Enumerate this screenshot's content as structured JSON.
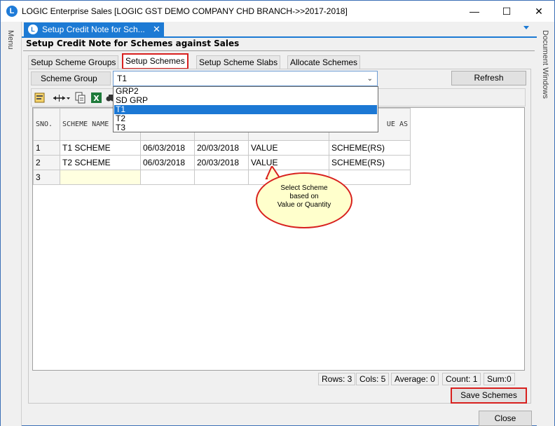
{
  "window": {
    "title": "LOGIC Enterprise Sales  [LOGIC GST DEMO COMPANY CHD BRANCH->>2017-2018]",
    "logo_letter": "L",
    "minimize": "—",
    "maximize": "☐",
    "close": "✕"
  },
  "side_rails": {
    "left_label": "Menu",
    "right_label": "Document Windows"
  },
  "doc_tab": {
    "label": "Setup Credit Note for Sch...",
    "close": "✕"
  },
  "form": {
    "title": "Setup Credit Note for Schemes against Sales"
  },
  "subtabs": [
    {
      "label": "Setup Scheme Groups",
      "active": false
    },
    {
      "label": "Setup Schemes",
      "active": true
    },
    {
      "label": "Setup Scheme Slabs",
      "active": false
    },
    {
      "label": "Allocate Schemes",
      "active": false
    }
  ],
  "scheme_group": {
    "label": "Scheme Group",
    "selected": "T1",
    "options": [
      "GRP2",
      "SD GRP",
      "T1",
      "T2",
      "T3"
    ]
  },
  "refresh_label": "Refresh",
  "toolbar_icons": [
    "form-icon",
    "column-resize-icon",
    "copy-icon",
    "excel-icon",
    "find-icon"
  ],
  "grid": {
    "headers": [
      "SNO.",
      "SCHEME NAME",
      "",
      "",
      "",
      "UE AS"
    ],
    "rows": [
      {
        "sno": "1",
        "name": "T1 SCHEME",
        "from": "06/03/2018",
        "to": "20/03/2018",
        "type": "VALUE",
        "as": "SCHEME(RS)"
      },
      {
        "sno": "2",
        "name": "T2 SCHEME",
        "from": "06/03/2018",
        "to": "20/03/2018",
        "type": "VALUE",
        "as": "SCHEME(RS)"
      },
      {
        "sno": "3",
        "name": "",
        "from": "",
        "to": "",
        "type": "",
        "as": ""
      }
    ]
  },
  "callout": {
    "text_line1": "Select Scheme",
    "text_line2": "based on",
    "text_line3": "Value or Quantity"
  },
  "status": {
    "rows": "Rows: 3",
    "cols": "Cols: 5",
    "average": "Average: 0",
    "count": "Count: 1",
    "sum": "Sum:0"
  },
  "save_label": "Save Schemes",
  "close_label": "Close",
  "colors": {
    "accent": "#1c7ad4",
    "highlight": "#d8201e",
    "callout_fill": "#ffffcc"
  }
}
